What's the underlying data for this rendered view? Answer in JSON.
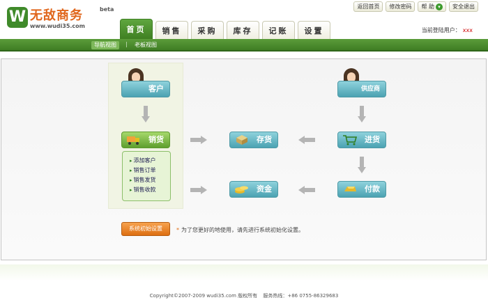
{
  "app": {
    "brand_name": "无敌商务",
    "brand_url": "www.wudi35.com",
    "brand_mark": "W",
    "beta": "beta"
  },
  "top_links": [
    {
      "label": "返回首页"
    },
    {
      "label": "修改密码"
    },
    {
      "label": "帮 助",
      "icon": "help-icon",
      "icon_glyph": "▾"
    },
    {
      "label": "安全退出"
    }
  ],
  "tabs": [
    {
      "label": "首页",
      "active": true
    },
    {
      "label": "销售"
    },
    {
      "label": "采购"
    },
    {
      "label": "库存"
    },
    {
      "label": "记账"
    },
    {
      "label": "设置"
    }
  ],
  "user": {
    "label": "当前登陆用户：",
    "name": "xxx"
  },
  "subnav": {
    "items": [
      {
        "label": "导航视图",
        "active": true
      },
      {
        "label": "老板视图"
      }
    ],
    "separator": "|"
  },
  "flow": {
    "customer": "客户",
    "supplier": "供应商",
    "sales": "销货",
    "inventory": "存货",
    "purchase": "进货",
    "funds": "资金",
    "payment": "付款"
  },
  "sales_menu": [
    "添加客户",
    "销售订单",
    "销售发货",
    "销售收款"
  ],
  "init": {
    "button": "系统初始设置",
    "star": "*",
    "note": "为了您更好的地使用，请先进行系统初始化设置。"
  },
  "footer": {
    "copyright": "Copyright©2007-2009 wudi35.com 版权所有",
    "hotline": "服务热线：+86 0755-86329683"
  },
  "colors": {
    "brand_green": "#3f7d24",
    "brand_orange": "#e0661c",
    "node_teal": "#4ba2b2",
    "node_green": "#5f9f2e"
  }
}
